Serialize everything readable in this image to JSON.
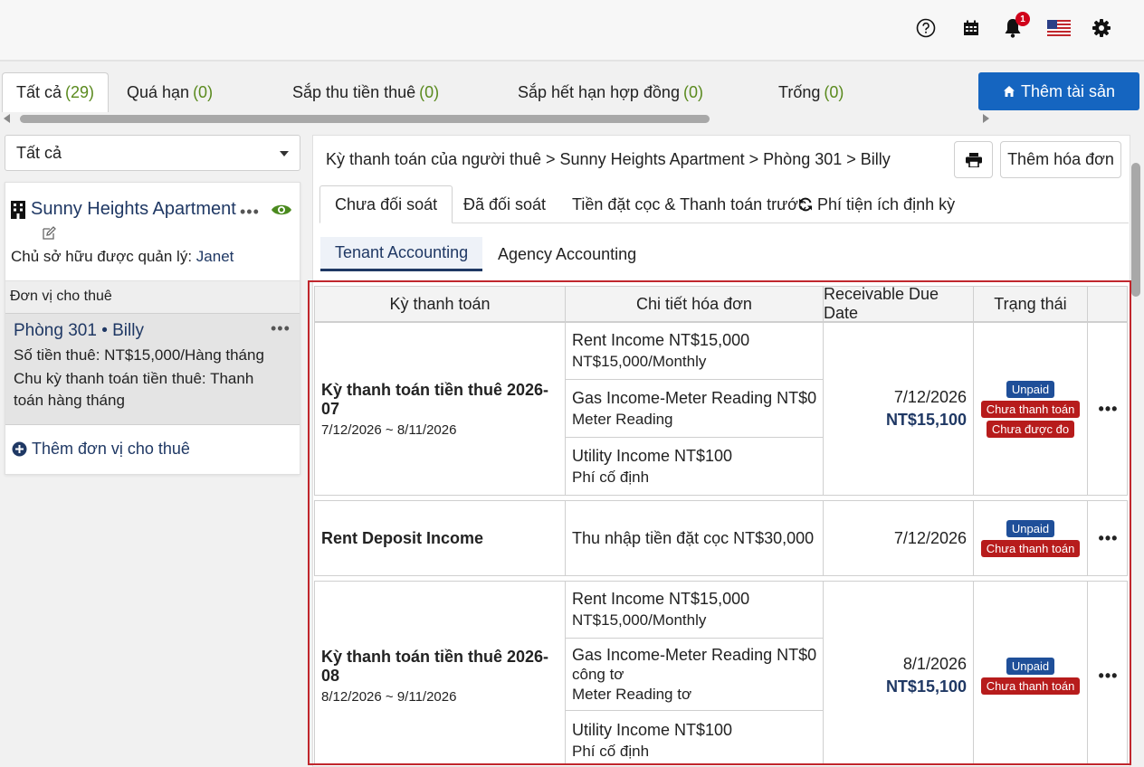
{
  "topbar": {
    "icons": [
      "help-icon",
      "calendar-icon",
      "bell-icon",
      "us-flag-icon",
      "gear-icon"
    ],
    "notification_count": "1"
  },
  "main_tabs": [
    {
      "label": "Tất cả",
      "count": "(29)"
    },
    {
      "label": "Quá hạn",
      "count": "(0)"
    },
    {
      "label": "Sắp thu tiền thuê",
      "count": "(0)"
    },
    {
      "label": "Sắp hết hạn hợp đồng",
      "count": "(0)"
    },
    {
      "label": "Trống",
      "count": "(0)"
    }
  ],
  "add_property_label": "Thêm tài sản",
  "filter": {
    "selected": "Tất cả"
  },
  "property": {
    "name": "Sunny Heights Apartment",
    "owner_label": "Chủ sở hữu được quản lý:",
    "owner_name": "Janet",
    "units_header": "Đơn vị cho thuê",
    "unit": {
      "title": "Phòng 301 • Billy",
      "rent": "Số tiền thuê: NT$15,000/Hàng tháng",
      "cycle": "Chu kỳ thanh toán tiền thuê: Thanh toán hàng tháng"
    },
    "add_unit_label": "Thêm đơn vị cho thuê"
  },
  "breadcrumb": "Kỳ thanh toán của người thuê > Sunny Heights Apartment > Phòng 301 > Billy",
  "add_invoice_label": "Thêm hóa đơn",
  "sub_tabs": [
    "Chưa đối soát",
    "Đã đối soát",
    "Tiền đặt cọc & Thanh toán trước",
    "Phí tiện ích định kỳ"
  ],
  "accounting_tabs": [
    "Tenant Accounting",
    "Agency Accounting"
  ],
  "table": {
    "headers": [
      "Kỳ thanh toán",
      "Chi tiết hóa đơn",
      "Receivable Due Date",
      "Trạng thái"
    ],
    "groups": [
      {
        "period_title": "Kỳ thanh toán tiền thuê 2026-07",
        "period_range": "7/12/2026 ~ 8/11/2026",
        "details": [
          {
            "line1": "Rent Income  NT$15,000",
            "line2": "NT$15,000/Monthly"
          },
          {
            "line1": "Gas Income-Meter Reading  NT$0",
            "line2": "Meter Reading"
          },
          {
            "line1": "Utility Income  NT$100",
            "line2": "Phí cố định"
          }
        ],
        "due_date": "7/12/2026",
        "due_amount": "NT$15,100",
        "statuses": [
          "Unpaid",
          "Chưa thanh toán",
          "Chưa được đo"
        ]
      },
      {
        "period_title": "Rent Deposit Income",
        "period_range": "",
        "details": [
          {
            "line1": "Thu nhập tiền đặt cọc  NT$30,000",
            "line2": ""
          }
        ],
        "due_date": "7/12/2026",
        "due_amount": "",
        "statuses": [
          "Unpaid",
          "Chưa thanh toán"
        ]
      },
      {
        "period_title": "Kỳ thanh toán tiền thuê 2026-08",
        "period_range": "8/12/2026 ~ 9/11/2026",
        "details": [
          {
            "line1": "Rent Income  NT$15,000",
            "line2": "NT$15,000/Monthly"
          },
          {
            "line1": "Gas Income-Meter Reading  NT$0",
            "line2": "công tơ",
            "line3": "Meter Reading tơ"
          },
          {
            "line1": "Utility Income  NT$100",
            "line2": "Phí cố định"
          }
        ],
        "due_date": "8/1/2026",
        "due_amount": "NT$15,100",
        "statuses": [
          "Unpaid",
          "Chưa thanh toán"
        ]
      }
    ],
    "more_label": "•••"
  },
  "colors": {
    "accent_blue": "#1565c0",
    "navy": "#1f3864",
    "count_green": "#5a8a1e",
    "badge_red": "#b71c1c",
    "badge_blue": "#1f4f99",
    "highlight_border": "#c0272d"
  }
}
